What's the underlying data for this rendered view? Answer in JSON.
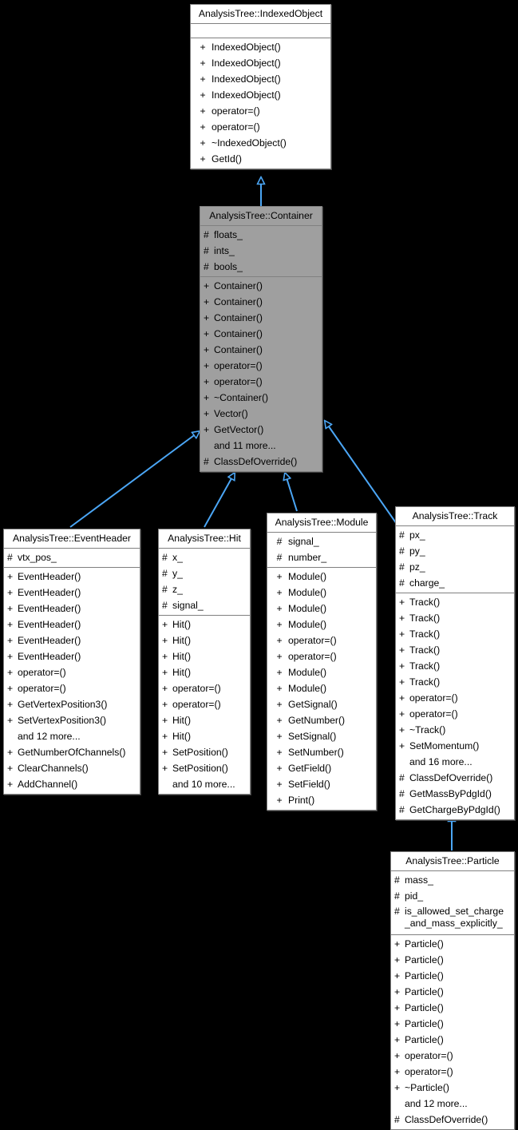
{
  "diagram": {
    "kind": "uml-inheritance-diagram",
    "background": "#000000",
    "edge_color": "#4BA6F5",
    "highlight_color": "#9f9f9f",
    "box_fill": "#ffffff",
    "box_border": "#808080"
  },
  "classes": {
    "indexed_object": {
      "title": "AnalysisTree::IndexedObject",
      "attributes": [],
      "methods": [
        {
          "vis": "+",
          "name": "IndexedObject()"
        },
        {
          "vis": "+",
          "name": "IndexedObject()"
        },
        {
          "vis": "+",
          "name": "IndexedObject()"
        },
        {
          "vis": "+",
          "name": "IndexedObject()"
        },
        {
          "vis": "+",
          "name": "operator=()"
        },
        {
          "vis": "+",
          "name": "operator=()"
        },
        {
          "vis": "+",
          "name": "~IndexedObject()"
        },
        {
          "vis": "+",
          "name": "GetId()"
        }
      ]
    },
    "container": {
      "title": "AnalysisTree::Container",
      "attributes": [
        {
          "vis": "#",
          "name": "floats_"
        },
        {
          "vis": "#",
          "name": "ints_"
        },
        {
          "vis": "#",
          "name": "bools_"
        }
      ],
      "methods": [
        {
          "vis": "+",
          "name": "Container()"
        },
        {
          "vis": "+",
          "name": "Container()"
        },
        {
          "vis": "+",
          "name": "Container()"
        },
        {
          "vis": "+",
          "name": "Container()"
        },
        {
          "vis": "+",
          "name": "Container()"
        },
        {
          "vis": "+",
          "name": "operator=()"
        },
        {
          "vis": "+",
          "name": "operator=()"
        },
        {
          "vis": "+",
          "name": "~Container()"
        },
        {
          "vis": "+",
          "name": "Vector()"
        },
        {
          "vis": "+",
          "name": "GetVector()"
        },
        {
          "vis": "",
          "name": "and 11 more..."
        },
        {
          "vis": "#",
          "name": "ClassDefOverride()"
        }
      ]
    },
    "event_header": {
      "title": "AnalysisTree::EventHeader",
      "attributes": [
        {
          "vis": "#",
          "name": "vtx_pos_"
        }
      ],
      "methods": [
        {
          "vis": "+",
          "name": "EventHeader()"
        },
        {
          "vis": "+",
          "name": "EventHeader()"
        },
        {
          "vis": "+",
          "name": "EventHeader()"
        },
        {
          "vis": "+",
          "name": "EventHeader()"
        },
        {
          "vis": "+",
          "name": "EventHeader()"
        },
        {
          "vis": "+",
          "name": "EventHeader()"
        },
        {
          "vis": "+",
          "name": "operator=()"
        },
        {
          "vis": "+",
          "name": "operator=()"
        },
        {
          "vis": "+",
          "name": "GetVertexPosition3()"
        },
        {
          "vis": "+",
          "name": "SetVertexPosition3()"
        },
        {
          "vis": "",
          "name": "and 12 more..."
        },
        {
          "vis": "+",
          "name": "GetNumberOfChannels()"
        },
        {
          "vis": "+",
          "name": "ClearChannels()"
        },
        {
          "vis": "+",
          "name": "AddChannel()"
        }
      ]
    },
    "hit": {
      "title": "AnalysisTree::Hit",
      "attributes": [
        {
          "vis": "#",
          "name": "x_"
        },
        {
          "vis": "#",
          "name": "y_"
        },
        {
          "vis": "#",
          "name": "z_"
        },
        {
          "vis": "#",
          "name": "signal_"
        }
      ],
      "methods": [
        {
          "vis": "+",
          "name": "Hit()"
        },
        {
          "vis": "+",
          "name": "Hit()"
        },
        {
          "vis": "+",
          "name": "Hit()"
        },
        {
          "vis": "+",
          "name": "Hit()"
        },
        {
          "vis": "+",
          "name": "operator=()"
        },
        {
          "vis": "+",
          "name": "operator=()"
        },
        {
          "vis": "+",
          "name": "Hit()"
        },
        {
          "vis": "+",
          "name": "Hit()"
        },
        {
          "vis": "+",
          "name": "SetPosition()"
        },
        {
          "vis": "+",
          "name": "SetPosition()"
        },
        {
          "vis": "",
          "name": "and 10 more..."
        }
      ]
    },
    "module": {
      "title": "AnalysisTree::Module",
      "attributes": [
        {
          "vis": "#",
          "name": "signal_"
        },
        {
          "vis": "#",
          "name": "number_"
        }
      ],
      "methods": [
        {
          "vis": "+",
          "name": "Module()"
        },
        {
          "vis": "+",
          "name": "Module()"
        },
        {
          "vis": "+",
          "name": "Module()"
        },
        {
          "vis": "+",
          "name": "Module()"
        },
        {
          "vis": "+",
          "name": "operator=()"
        },
        {
          "vis": "+",
          "name": "operator=()"
        },
        {
          "vis": "+",
          "name": "Module()"
        },
        {
          "vis": "+",
          "name": "Module()"
        },
        {
          "vis": "+",
          "name": "GetSignal()"
        },
        {
          "vis": "+",
          "name": "GetNumber()"
        },
        {
          "vis": "+",
          "name": "SetSignal()"
        },
        {
          "vis": "+",
          "name": "SetNumber()"
        },
        {
          "vis": "+",
          "name": "GetField()"
        },
        {
          "vis": "+",
          "name": "SetField()"
        },
        {
          "vis": "+",
          "name": "Print()"
        }
      ]
    },
    "track": {
      "title": "AnalysisTree::Track",
      "attributes": [
        {
          "vis": "#",
          "name": "px_"
        },
        {
          "vis": "#",
          "name": "py_"
        },
        {
          "vis": "#",
          "name": "pz_"
        },
        {
          "vis": "#",
          "name": "charge_"
        }
      ],
      "methods": [
        {
          "vis": "+",
          "name": "Track()"
        },
        {
          "vis": "+",
          "name": "Track()"
        },
        {
          "vis": "+",
          "name": "Track()"
        },
        {
          "vis": "+",
          "name": "Track()"
        },
        {
          "vis": "+",
          "name": "Track()"
        },
        {
          "vis": "+",
          "name": "Track()"
        },
        {
          "vis": "+",
          "name": "operator=()"
        },
        {
          "vis": "+",
          "name": "operator=()"
        },
        {
          "vis": "+",
          "name": "~Track()"
        },
        {
          "vis": "+",
          "name": "SetMomentum()"
        },
        {
          "vis": "",
          "name": "and 16 more..."
        },
        {
          "vis": "#",
          "name": "ClassDefOverride()"
        },
        {
          "vis": "#",
          "name": "GetMassByPdgId()"
        },
        {
          "vis": "#",
          "name": "GetChargeByPdgId()"
        }
      ]
    },
    "particle": {
      "title": "AnalysisTree::Particle",
      "attributes": [
        {
          "vis": "#",
          "name": "mass_"
        },
        {
          "vis": "#",
          "name": "pid_"
        },
        {
          "vis": "#",
          "name": "is_allowed_set_charge",
          "name2": "_and_mass_explicitly_"
        }
      ],
      "methods": [
        {
          "vis": "+",
          "name": "Particle()"
        },
        {
          "vis": "+",
          "name": "Particle()"
        },
        {
          "vis": "+",
          "name": "Particle()"
        },
        {
          "vis": "+",
          "name": "Particle()"
        },
        {
          "vis": "+",
          "name": "Particle()"
        },
        {
          "vis": "+",
          "name": "Particle()"
        },
        {
          "vis": "+",
          "name": "Particle()"
        },
        {
          "vis": "+",
          "name": "operator=()"
        },
        {
          "vis": "+",
          "name": "operator=()"
        },
        {
          "vis": "+",
          "name": "~Particle()"
        },
        {
          "vis": "",
          "name": "and 12 more..."
        },
        {
          "vis": "#",
          "name": "ClassDefOverride()"
        }
      ]
    }
  },
  "edges": [
    {
      "from": "container",
      "to": "indexed_object"
    },
    {
      "from": "event_header",
      "to": "container"
    },
    {
      "from": "hit",
      "to": "container"
    },
    {
      "from": "module",
      "to": "container"
    },
    {
      "from": "track",
      "to": "container"
    },
    {
      "from": "particle",
      "to": "track"
    }
  ]
}
